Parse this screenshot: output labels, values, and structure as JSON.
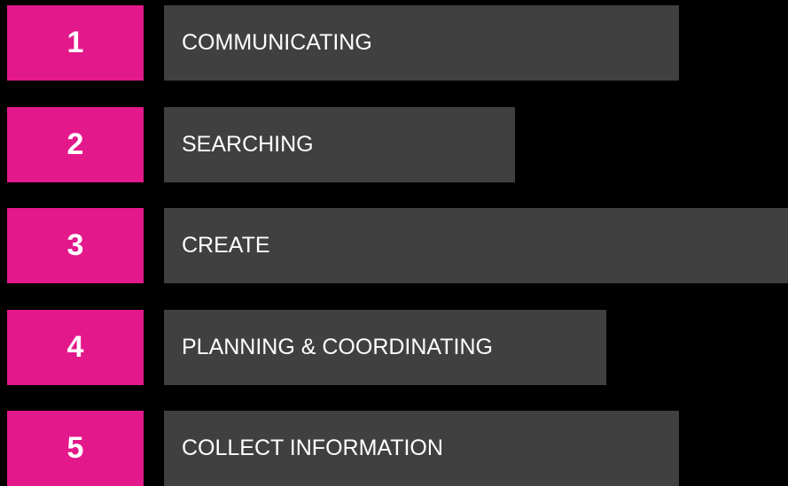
{
  "colors": {
    "background": "#000000",
    "number_box": "#e3198b",
    "bar": "#404040",
    "text": "#ffffff"
  },
  "items": [
    {
      "number": "1",
      "label": "COMMUNICATING"
    },
    {
      "number": "2",
      "label": "SEARCHING"
    },
    {
      "number": "3",
      "label": "CREATE"
    },
    {
      "number": "4",
      "label": "PLANNING & COORDINATING"
    },
    {
      "number": "5",
      "label": "COLLECT INFORMATION"
    }
  ]
}
